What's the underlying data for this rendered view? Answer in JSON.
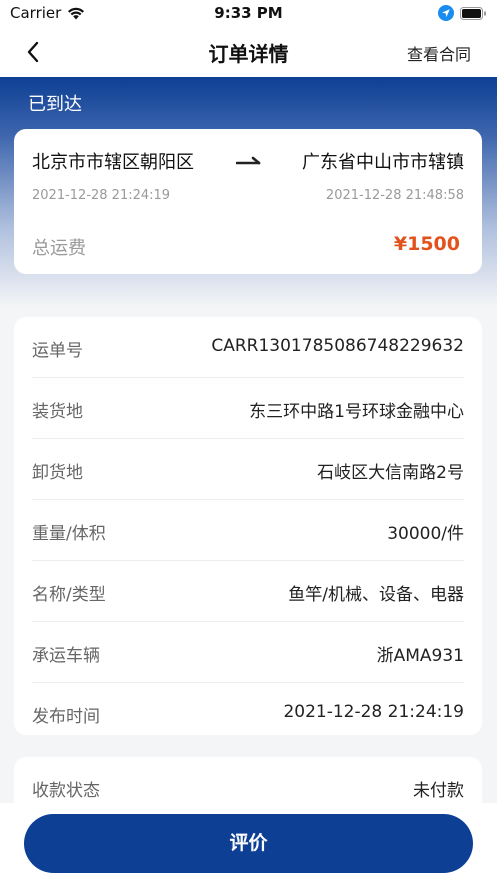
{
  "status_bar": {
    "carrier": "Carrier",
    "time": "9:33 PM"
  },
  "nav": {
    "title": "订单详情",
    "contract_label": "查看合同"
  },
  "order": {
    "status": "已到达",
    "from": "北京市市辖区朝阳区",
    "to": "广东省中山市市辖镇",
    "from_time": "2021-12-28 21:24:19",
    "to_time": "2021-12-28 21:48:58",
    "fee_label": "总运费",
    "fee_value": "¥1500"
  },
  "details": [
    {
      "label": "运单号",
      "value": "CARR1301785086748229632"
    },
    {
      "label": "装货地",
      "value": "东三环中路1号环球金融中心"
    },
    {
      "label": "卸货地",
      "value": "石岐区大信南路2号"
    },
    {
      "label": "重量/体积",
      "value": "30000/件"
    },
    {
      "label": "名称/类型",
      "value": "鱼竿/机械、设备、电器"
    },
    {
      "label": "承运车辆",
      "value": "浙AMA931"
    },
    {
      "label": "发布时间",
      "value": "2021-12-28 21:24:19"
    }
  ],
  "payment": {
    "label": "收款状态",
    "value": "未付款"
  },
  "actions": {
    "rate_label": "评价"
  },
  "colors": {
    "primary": "#0d3f94",
    "fee": "#e2521d"
  }
}
